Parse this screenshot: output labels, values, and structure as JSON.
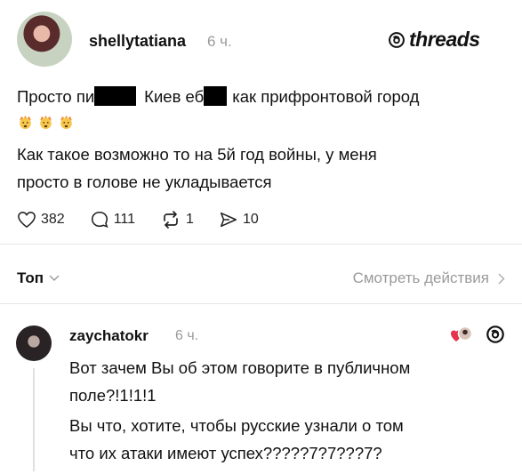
{
  "post": {
    "username": "shellytatiana",
    "time": "6 ч.",
    "brand": "threads",
    "line1_part1": "Просто пи",
    "line1_part2": "Киев еб",
    "line1_part3": "как прифронтовой город",
    "body_line2": "Как такое возможно то на 5й год войны, у меня",
    "body_line3": "просто в голове не укладывается",
    "likes": "382",
    "comments": "111",
    "reposts": "1",
    "shares": "10"
  },
  "controls": {
    "sort_label": "Топ",
    "view_activity_label": "Смотреть действия"
  },
  "reply": {
    "username": "zaychatokr",
    "time": "6 ч.",
    "line1": "Вот зачем Вы об этом говорите в публичном",
    "line2": "поле?!1!1!1",
    "line3": "Вы что, хотите, чтобы русские узнали о том",
    "line4": "что их атаки имеют успех?????7?7???7?"
  }
}
